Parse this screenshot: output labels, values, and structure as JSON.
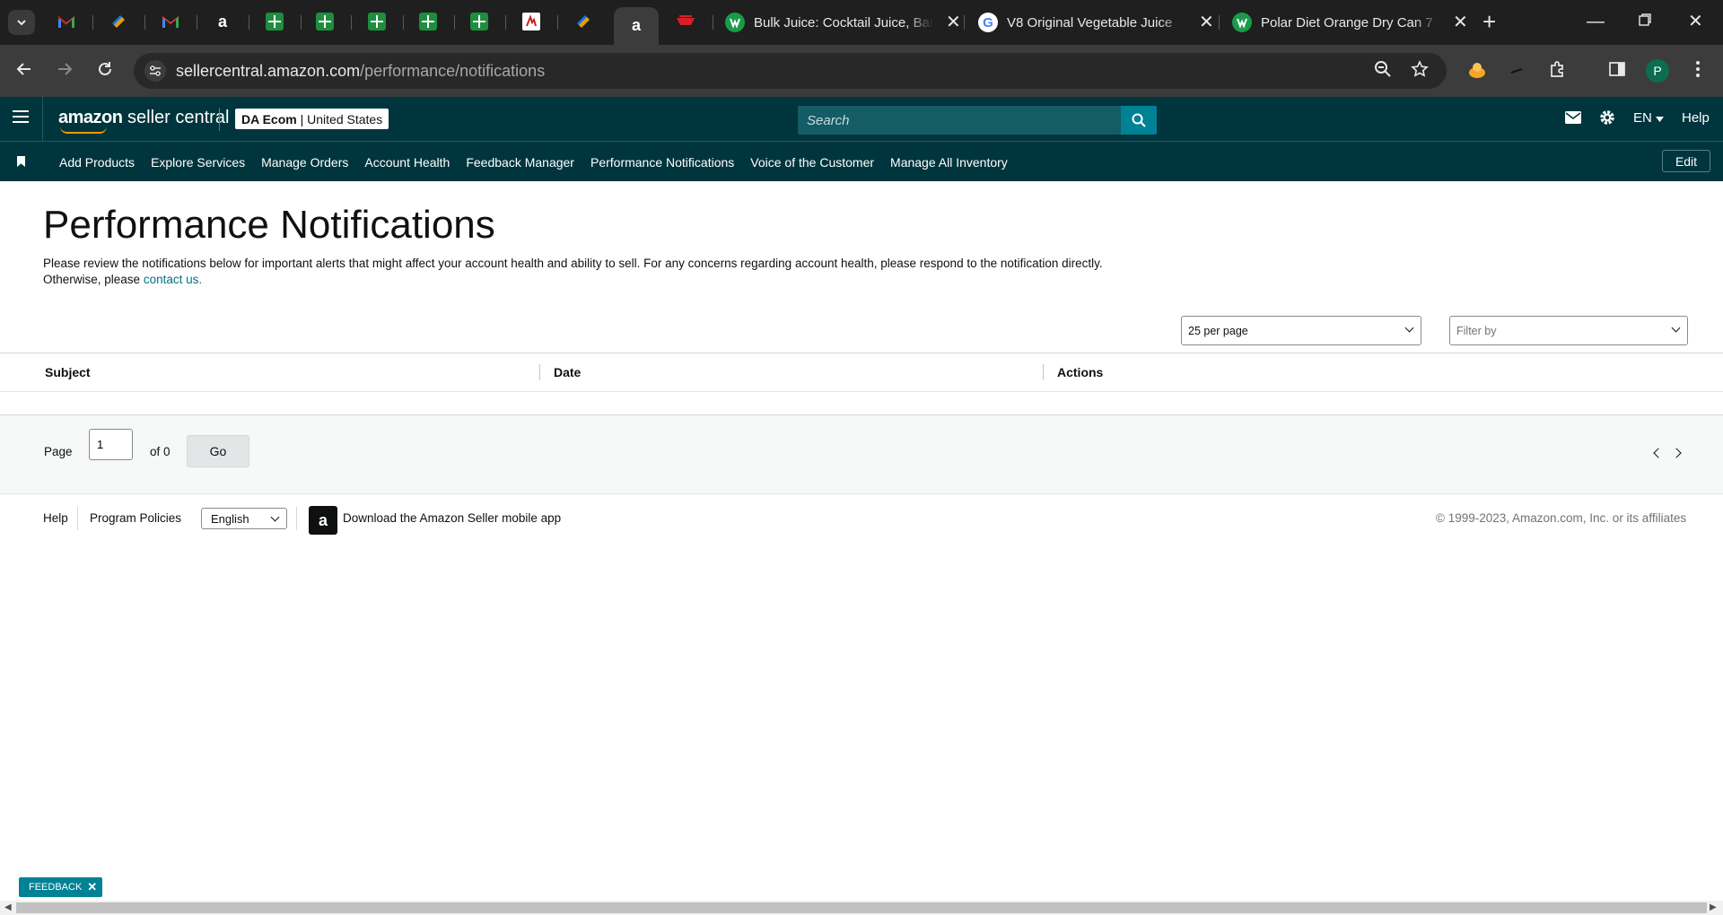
{
  "browser": {
    "tabs": [
      {
        "title": "Bulk Juice: Cocktail Juice, Bar",
        "icon": "webstaurant-icon"
      },
      {
        "title": "V8 Original Vegetable Juice",
        "icon": "google-icon"
      },
      {
        "title": "Polar Diet Orange Dry Can 7",
        "icon": "webstaurant-icon"
      }
    ],
    "url_host": "sellercentral.amazon.com",
    "url_path": "/performance/notifications",
    "profile_initial": "P"
  },
  "header": {
    "logo_brand": "amazon",
    "logo_product": "seller central",
    "account_name": "DA Ecom",
    "account_region": "United States",
    "search_placeholder": "Search",
    "language": "EN",
    "help": "Help"
  },
  "nav": {
    "links": [
      "Add Products",
      "Explore Services",
      "Manage Orders",
      "Account Health",
      "Feedback Manager",
      "Performance Notifications",
      "Voice of the Customer",
      "Manage All Inventory"
    ],
    "edit_label": "Edit"
  },
  "main": {
    "title": "Performance Notifications",
    "description": "Please review the notifications below for important alerts that might affect your account health and ability to sell. For any concerns regarding account health, please respond to the notification directly. Otherwise, please ",
    "contact_link": "contact us.",
    "per_page": "25 per page",
    "filter_placeholder": "Filter by",
    "columns": [
      "Subject",
      "Date",
      "Actions"
    ]
  },
  "pagination": {
    "page_label": "Page",
    "current_page": "1",
    "of_label": "of 0",
    "go_label": "Go"
  },
  "footer": {
    "help": "Help",
    "program_policies": "Program Policies",
    "language": "English",
    "app_text": "Download the Amazon Seller mobile app",
    "copyright": "© 1999-2023, Amazon.com, Inc. or its affiliates"
  },
  "feedback": {
    "label": "FEEDBACK"
  },
  "colors": {
    "header_bg": "#00353d",
    "accent": "#008296",
    "link": "#007185"
  }
}
